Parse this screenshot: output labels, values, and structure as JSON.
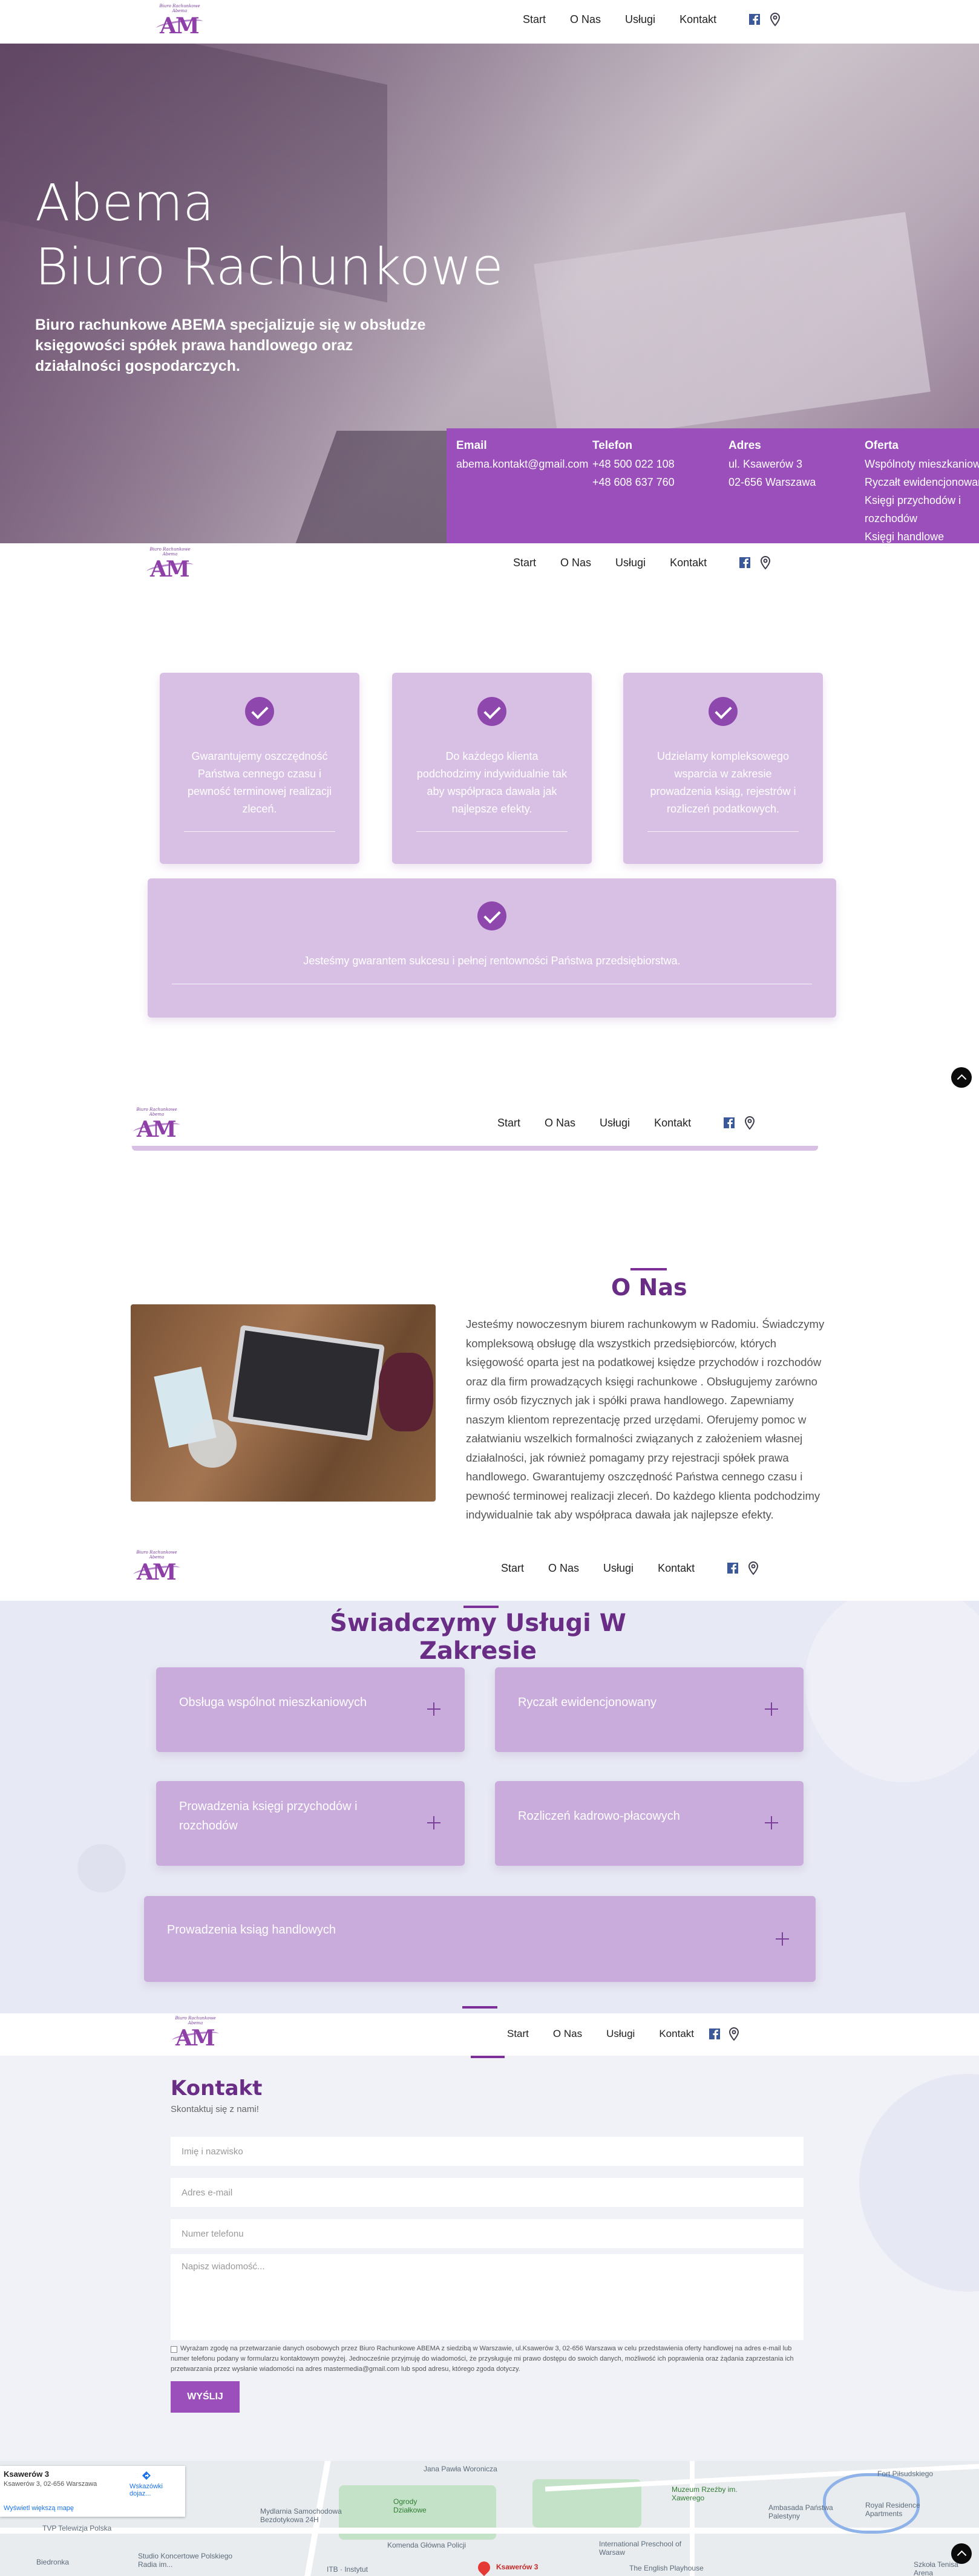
{
  "nav": {
    "logo_tagline": "Biuro Rachunkowe Abema",
    "logo_mark": "AM",
    "items": [
      "Start",
      "O Nas",
      "Usługi",
      "Kontakt"
    ]
  },
  "hero": {
    "title_line1": "Abema",
    "title_line2": "Biuro Rachunkowe",
    "text": "Biuro rachunkowe ABEMA specjalizuje się w obsłudze księgowości spółek prawa handlowego oraz działalności gospodarczych."
  },
  "info": {
    "email": {
      "heading": "Email",
      "value": "abema.kontakt@gmail.com"
    },
    "phone": {
      "heading": "Telefon",
      "line1": "+48 500 022 108",
      "line2": "+48 608 637 760"
    },
    "address": {
      "heading": "Adres",
      "line1": "ul. Ksawerów 3",
      "line2": "02-656 Warszawa"
    },
    "offer": {
      "heading": "Oferta",
      "items": [
        "Wspólnoty mieszkaniowe",
        "Ryczałt ewidencjonowany",
        "Księgi przychodów i",
        "rozchodów",
        "Księgi handlowe"
      ]
    }
  },
  "features": [
    "Gwarantujemy oszczędność Państwa cennego czasu i pewność terminowej realizacji zleceń.",
    "Do każdego klienta podchodzimy indywidualnie tak aby współpraca dawała jak najlepsze efekty.",
    "Udzielamy kompleksowego wsparcia w zakresie prowadzenia ksiąg, rejestrów i rozliczeń podatkowych.",
    "Jesteśmy gwarantem sukcesu i pełnej rentowności Państwa przedsiębiorstwa."
  ],
  "about": {
    "title": "O Nas",
    "text": "Jesteśmy nowoczesnym biurem rachunkowym w Radomiu. Świadczymy kompleksową obsługę dla wszystkich przedsiębiorców, których księgowość oparta jest na podatkowej księdze przychodów i rozchodów oraz dla firm prowadzących księgi rachunkowe . Obsługujemy zarówno firmy osób fizycznych jak i spółki prawa handlowego. Zapewniamy naszym klientom reprezentację przed urzędami. Oferujemy pomoc w załatwianiu wszelkich formalności związanych z założeniem własnej działalności, jak również pomagamy przy rejestracji spółek prawa handlowego. Gwarantujemy oszczędność Państwa cennego czasu i pewność terminowej realizacji zleceń. Do każdego klienta podchodzimy indywidualnie tak aby współpraca dawała jak najlepsze efekty."
  },
  "services": {
    "title": "Świadczymy Usługi W Zakresie",
    "items": [
      "Obsługa wspólnot mieszkaniowych",
      "Ryczałt ewidencjonowany",
      "Prowadzenia księgi przychodów i rozchodów",
      "Rozliczeń kadrowo-płacowych",
      "Prowadzenia ksiąg handlowych"
    ]
  },
  "contact": {
    "title": "Kontakt",
    "subtitle": "Skontaktuj się z nami!",
    "placeholders": {
      "name": "Imię i nazwisko",
      "email": "Adres e-mail",
      "phone": "Numer telefonu",
      "message": "Napisz wiadomość..."
    },
    "consent": "Wyrażam zgodę na przetwarzanie danych osobowych przez Biuro Rachunkowe ABEMA z siedzibą w Warszawie, ul.Ksawerów 3, 02-656 Warszawa w celu przedstawienia oferty handlowej na adres e-mail lub numer telefonu podany w formularzu kontaktowym powyżej. Jednocześnie przyjmuję do wiadomości, że przysługuje mi prawo dostępu do swoich danych, możliwość ich poprawienia oraz żądania zaprzestania ich przetwarzania przez wysłanie wiadomości na adres mastermedia@gmail.com lub spod adresu, którego zgoda dotyczy.",
    "submit": "WYŚLIJ"
  },
  "map": {
    "card_title": "Ksawerów 3",
    "card_address": "Ksawerów 3, 02-656 Warszawa",
    "directions": "Wskazówki dojaz...",
    "larger_map": "Wyświetl większą mapę",
    "labels": [
      "TVP Telewizja Polska",
      "Studio Koncertowe Polskiego Radia im...",
      "Jana Pawła Woronicza",
      "Muzeum Rzeźby im. Xawerego",
      "Ksawerów 3",
      "Komenda Główna Policji",
      "Ogrody Działkowe",
      "Royal Residence Apartments",
      "Fort Piłsudskiego",
      "Biedronka",
      "ITB · Instytut",
      "Szkoła Tenisa Arena",
      "The English Playhouse",
      "Ambasada Państwa Palestyny",
      "International Preschool of Warsaw",
      "Mydlarnia Samochodowa Bezdotykowa 24H"
    ]
  },
  "colors": {
    "brand_purple": "#9a4fba",
    "dark_purple": "#6a2d86",
    "card_lilac": "#d8c0e4",
    "service_lilac": "#c9abdc"
  }
}
